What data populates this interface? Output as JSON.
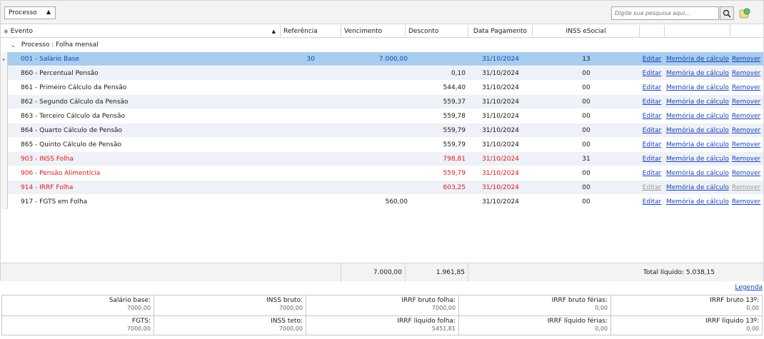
{
  "grouping": {
    "chip_label": "Processo"
  },
  "search": {
    "placeholder": "Digite sua pesquisa aqui..."
  },
  "columns": {
    "evento": "Evento",
    "referencia": "Referência",
    "vencimento": "Vencimento",
    "desconto": "Desconto",
    "data_pagamento": "Data Pagamento",
    "inss_esocial": "INSS eSocial"
  },
  "group_row": {
    "label": "Processo : Folha mensal"
  },
  "action_labels": {
    "edit": "Editar",
    "memory": "Memória de cálculo",
    "remove": "Remover"
  },
  "rows": [
    {
      "evento": "001 - Salário Base",
      "referencia": "30",
      "vencimento": "7.000,00",
      "desconto": "",
      "data": "31/10/2024",
      "inss": "13",
      "style": "selected"
    },
    {
      "evento": "860 - Percentual Pensão",
      "referencia": "",
      "vencimento": "",
      "desconto": "0,10",
      "data": "31/10/2024",
      "inss": "00",
      "style": "normal"
    },
    {
      "evento": "861 - Primeiro Cálculo da Pensão",
      "referencia": "",
      "vencimento": "",
      "desconto": "544,40",
      "data": "31/10/2024",
      "inss": "00",
      "style": "normal"
    },
    {
      "evento": "862 - Segundo Cálculo da Pensão",
      "referencia": "",
      "vencimento": "",
      "desconto": "559,37",
      "data": "31/10/2024",
      "inss": "00",
      "style": "normal"
    },
    {
      "evento": "863 - Terceiro Cálculo da Pensão",
      "referencia": "",
      "vencimento": "",
      "desconto": "559,78",
      "data": "31/10/2024",
      "inss": "00",
      "style": "normal"
    },
    {
      "evento": "864 - Quarto Cálculo de Pensão",
      "referencia": "",
      "vencimento": "",
      "desconto": "559,79",
      "data": "31/10/2024",
      "inss": "00",
      "style": "normal"
    },
    {
      "evento": "865 - Quinto Cálculo de Pensão",
      "referencia": "",
      "vencimento": "",
      "desconto": "559,79",
      "data": "31/10/2024",
      "inss": "00",
      "style": "normal"
    },
    {
      "evento": "903 - INSS Folha",
      "referencia": "",
      "vencimento": "",
      "desconto": "798,81",
      "data": "31/10/2024",
      "inss": "31",
      "style": "red"
    },
    {
      "evento": "906 - Pensão Alimentícia",
      "referencia": "",
      "vencimento": "",
      "desconto": "559,79",
      "data": "31/10/2024",
      "inss": "00",
      "style": "red"
    },
    {
      "evento": "914 - IRRF Folha",
      "referencia": "",
      "vencimento": "",
      "desconto": "603,25",
      "data": "31/10/2024",
      "inss": "00",
      "style": "red",
      "actions_disabled": true
    },
    {
      "evento": "917 - FGTS em Folha",
      "referencia": "",
      "vencimento": "560,00",
      "desconto": "",
      "data": "31/10/2024",
      "inss": "00",
      "style": "normal"
    }
  ],
  "totals": {
    "vencimento": "7.000,00",
    "desconto": "1.961,85",
    "liquido": "Total líquido: 5.038,15"
  },
  "legend_link": "Legenda",
  "summary": [
    [
      {
        "label": "Salário base:",
        "value": "7000,00"
      },
      {
        "label": "INSS bruto:",
        "value": "7000,00"
      },
      {
        "label": "IRRF bruto folha:",
        "value": "7000,00"
      },
      {
        "label": "IRRF bruto férias:",
        "value": "0,00"
      },
      {
        "label": "IRRF bruto 13º:",
        "value": "0,00"
      }
    ],
    [
      {
        "label": "FGTS:",
        "value": "7000,00"
      },
      {
        "label": "INSS teto:",
        "value": "7000,00"
      },
      {
        "label": "IRRF líquido folha:",
        "value": "5451,81"
      },
      {
        "label": "IRRF líquido férias:",
        "value": "0,00"
      },
      {
        "label": "IRRF líquido 13º:",
        "value": "0,00"
      }
    ]
  ],
  "colors": {
    "selected_row": "#a8cdef",
    "alt_row": "#eef1f7",
    "link": "#1a44b8",
    "discount_red": "#e01b1b"
  }
}
